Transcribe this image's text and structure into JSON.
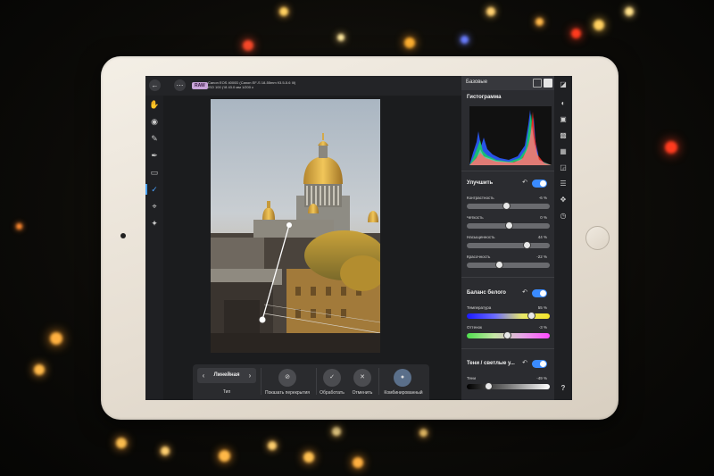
{
  "camera_info": {
    "raw_badge": "RAW",
    "line1": "Canon EOS 4000D (Canon EF-S 18-55mm f/3.5-5.6 III)",
    "line2": "ISO 100 ƒ/8 43.0 мм 1/200 с"
  },
  "left_tools": [
    "hand-icon",
    "eye-icon",
    "brush-icon",
    "pen-icon",
    "eraser-icon",
    "gradient-icon",
    "crop-icon",
    "wand-icon"
  ],
  "bottom_toolbar": {
    "segment_value": "Линейная",
    "segment_caption": "Тип",
    "show_overlays_label": "Показать перекрытия",
    "apply_label": "Обработать",
    "cancel_label": "Отменить",
    "blend_label": "Комбинированный"
  },
  "panel": {
    "title": "Базовые",
    "histogram_title": "Гистограмма",
    "enhance_title": "Улучшить",
    "contrast": {
      "label": "Контрастность",
      "value_text": "-6 %",
      "value": -6
    },
    "clarity": {
      "label": "Четкость",
      "value_text": "0 %",
      "value": 0
    },
    "saturation": {
      "label": "Насыщенность",
      "value_text": "44 %",
      "value": 44
    },
    "vibrance": {
      "label": "Красочность",
      "value_text": "-22 %",
      "value": -22
    },
    "wb_title": "Баланс белого",
    "temperature": {
      "label": "Температура",
      "value_text": "55 %",
      "value": 55
    },
    "tint": {
      "label": "Оттенок",
      "value_text": "-3 %",
      "value": -3
    },
    "shadows_title": "Тени / светлые у...",
    "shadows": {
      "label": "Тени",
      "value_text": "-49 %",
      "value": -49
    }
  },
  "colors": {
    "accent": "#3a8bff",
    "panel_bg": "#2b2c30"
  }
}
